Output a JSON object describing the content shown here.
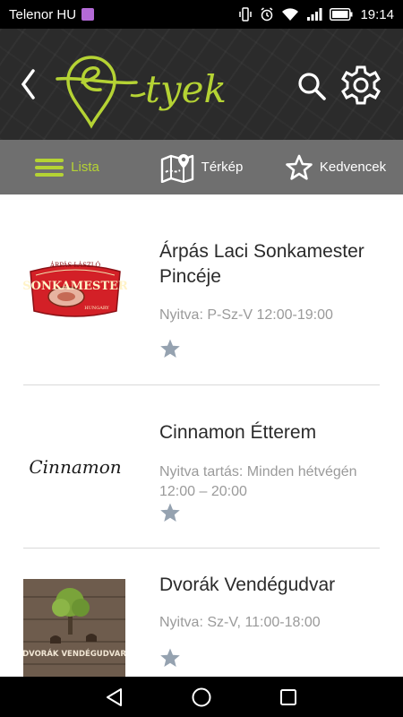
{
  "status_bar": {
    "carrier": "Telenor HU",
    "time": "19:14",
    "icons": [
      "image-notification-icon",
      "vibrate-icon",
      "alarm-icon",
      "wifi-icon",
      "signal-icon",
      "battery-icon"
    ]
  },
  "header": {
    "back_icon": "chevron-left-icon",
    "logo_text": "e-tyek",
    "search_icon": "search-icon",
    "settings_icon": "gear-icon",
    "accent_color": "#b5d334"
  },
  "tabs": [
    {
      "label": "Lista",
      "icon": "hamburger-icon",
      "active": true
    },
    {
      "label": "Térkép",
      "icon": "map-icon",
      "active": false
    },
    {
      "label": "Kedvencek",
      "icon": "star-outline-icon",
      "active": false
    }
  ],
  "venues": [
    {
      "title": "Árpás Laci Sonkamester Pincéje",
      "hours": "Nyitva: P-Sz-V 12:00-19:00",
      "logo_top": "ÁRPÁS LÁSZLÓ",
      "logo_main": "SONKAMESTER",
      "logo_bottom": "HUNGARY"
    },
    {
      "title": "Cinnamon Étterem",
      "hours": "Nyitva tartás: Minden hétvégén 12:00 – 20:00",
      "logo_main": "Cinnamon"
    },
    {
      "title": "Dvorák Vendégudvar",
      "hours": "Nyitva: Sz-V, 11:00-18:00",
      "logo_main": "DVORÁK VENDÉGUDVAR"
    }
  ],
  "nav_bar": {
    "back_icon": "nav-back-icon",
    "home_icon": "nav-home-icon",
    "recents_icon": "nav-recents-icon"
  }
}
